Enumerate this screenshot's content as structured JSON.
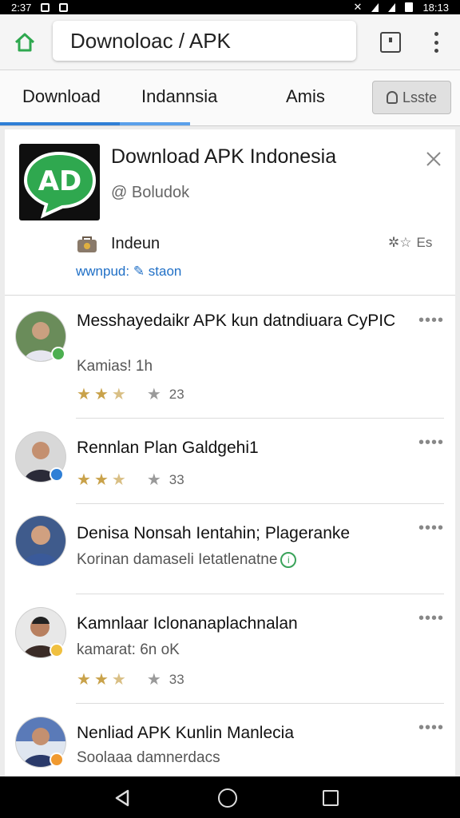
{
  "status_bar": {
    "time_left": "2:37",
    "time_right": "18:13"
  },
  "url_bar": {
    "url": "Downoloac / APK"
  },
  "tabs": [
    {
      "label": "Download"
    },
    {
      "label": "Indannsia"
    },
    {
      "label": "Amis"
    }
  ],
  "tab_button": {
    "label": "Lsste"
  },
  "app": {
    "logo_text": "AD",
    "title": "Download APK Indonesia",
    "developer": "@ Boludok",
    "label": "Indeun",
    "rating_text": "Es",
    "link": "wwnpud: ",
    "link_suffix": "staon"
  },
  "reviews": [
    {
      "title": "Messhayedaikr APK kun datndiuara CyPIC",
      "subtitle": "Kamias! 1h",
      "count": "23",
      "avatar_color": "#6a8c5a",
      "badge_color": "#4caf50"
    },
    {
      "title": "Rennlan Plan Galdgehi1",
      "subtitle": "",
      "count": "33",
      "avatar_color": "#3a3a48",
      "badge_color": "#2f7fd6"
    },
    {
      "title": "Denisa Nonsah Ientahin; Plageranke",
      "subtitle": "Korinan damaseli Ietatlenatne",
      "count": "",
      "avatar_color": "#3f5b8c",
      "badge_color": ""
    },
    {
      "title": "Kamnlaar Iclonanaplachnalan",
      "subtitle": "kamarat: 6n oK",
      "count": "33",
      "avatar_color": "#4a3b36",
      "badge_color": "#f0c040"
    },
    {
      "title": "Nenliad APK Kunlin Manlecia",
      "subtitle": "Soolaaa damnerdacs",
      "count": "",
      "avatar_color": "#2a3a6a",
      "badge_color": "#f09a30"
    }
  ],
  "colors": {
    "accent": "#2f7fd6",
    "brand_green": "#2fa84f",
    "star": "#c9a24a",
    "link": "#1f6fc6"
  }
}
